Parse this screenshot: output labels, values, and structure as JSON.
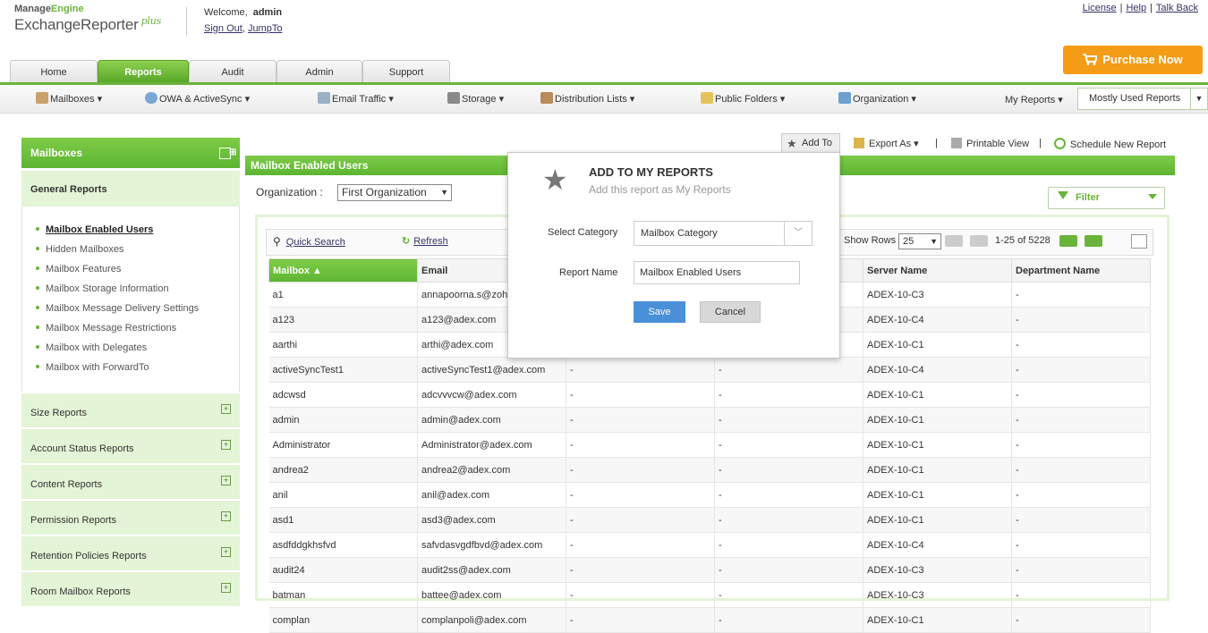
{
  "brand": {
    "line1a": "Manage",
    "line1b": "Engine",
    "line2": "ExchangeReporter",
    "line2_suffix": "plus"
  },
  "header": {
    "welcome_label": "Welcome,",
    "user": "admin",
    "sign_out": "Sign Out",
    "link_sep": ",",
    "jump_to": "JumpTo",
    "top_links": [
      "License",
      "Help",
      "Talk Back"
    ],
    "top_sep": "|",
    "purchase": "Purchase Now"
  },
  "tabs": [
    "Home",
    "Reports",
    "Audit",
    "Admin",
    "Support"
  ],
  "active_tab": "Reports",
  "menubar": {
    "items": [
      "Mailboxes ▾",
      "OWA & ActiveSync ▾",
      "Email Traffic ▾",
      "Storage ▾",
      "Distribution Lists ▾",
      "Public Folders ▾",
      "Organization ▾"
    ],
    "my_reports": "My Reports ▾",
    "mostly_used": "Mostly Used Reports",
    "mostly_used_arrow": "▼"
  },
  "sidebar": {
    "title": "Mailboxes",
    "section": "General Reports",
    "items": [
      "Mailbox Enabled Users",
      "Hidden Mailboxes",
      "Mailbox Features",
      "Mailbox Storage Information",
      "Mailbox Message Delivery Settings",
      "Mailbox Message Restrictions",
      "Mailbox with Delegates",
      "Mailbox with ForwardTo"
    ],
    "categories": [
      "Size Reports",
      "Account Status Reports",
      "Content Reports",
      "Permission Reports",
      "Retention Policies Reports",
      "Room Mailbox Reports"
    ],
    "expand_symbol": "+",
    "header_symbol": "⊞"
  },
  "actions": {
    "add_to": "Add To",
    "export": "Export As ▾",
    "sep": "|",
    "printable": "Printable View",
    "schedule": "Schedule New Report"
  },
  "report": {
    "title": "Mailbox Enabled Users",
    "org_label": "Organization :",
    "org_value": "First Organization",
    "org_arrow": "▼",
    "filter": "Filter",
    "quick_search": "Quick Search",
    "refresh": "Refresh",
    "show_rows": "Show Rows",
    "rows_value": "25",
    "rows_arrow": "▼",
    "page_info": "1-25 of 5228",
    "columns": [
      "Mailbox ▲",
      "Email",
      "",
      "",
      "Server Name",
      "Department Name"
    ],
    "rows": [
      [
        "a1",
        "annapoorna.s@zoho",
        "",
        "",
        "ADEX-10-C3",
        "-"
      ],
      [
        "a123",
        "a123@adex.com",
        "",
        "",
        "ADEX-10-C4",
        "-"
      ],
      [
        "aarthi",
        "arthi@adex.com",
        "",
        "",
        "ADEX-10-C1",
        "-"
      ],
      [
        "activeSyncTest1",
        "activeSyncTest1@adex.com",
        "-",
        "-",
        "ADEX-10-C4",
        "-"
      ],
      [
        "adcwsd",
        "adcvvvcw@adex.com",
        "-",
        "-",
        "ADEX-10-C1",
        "-"
      ],
      [
        "admin",
        "admin@adex.com",
        "-",
        "-",
        "ADEX-10-C1",
        "-"
      ],
      [
        "Administrator",
        "Administrator@adex.com",
        "-",
        "-",
        "ADEX-10-C1",
        "-"
      ],
      [
        "andrea2",
        "andrea2@adex.com",
        "-",
        "-",
        "ADEX-10-C1",
        "-"
      ],
      [
        "anil",
        "anil@adex.com",
        "-",
        "-",
        "ADEX-10-C1",
        "-"
      ],
      [
        "asd1",
        "asd3@adex.com",
        "-",
        "-",
        "ADEX-10-C1",
        "-"
      ],
      [
        "asdfddgkhsfvd",
        "safvdasvgdfbvd@adex.com",
        "-",
        "-",
        "ADEX-10-C4",
        "-"
      ],
      [
        "audit24",
        "audit2ss@adex.com",
        "-",
        "-",
        "ADEX-10-C3",
        "-"
      ],
      [
        "batman",
        "battee@adex.com",
        "-",
        "-",
        "ADEX-10-C3",
        "-"
      ],
      [
        "complan",
        "complanpoli@adex.com",
        "-",
        "-",
        "ADEX-10-C1",
        "-"
      ]
    ]
  },
  "modal": {
    "title": "ADD TO MY REPORTS",
    "subtitle": "Add this report as My Reports",
    "category_label": "Select Category",
    "category_value": "Mailbox Category",
    "category_arrow": "﹀",
    "name_label": "Report Name",
    "name_value": "Mailbox Enabled Users",
    "save": "Save",
    "cancel": "Cancel"
  },
  "colors": {
    "brand_green": "#6bb33b",
    "purchase_orange": "#f49c16",
    "save_blue": "#4a90d9"
  }
}
